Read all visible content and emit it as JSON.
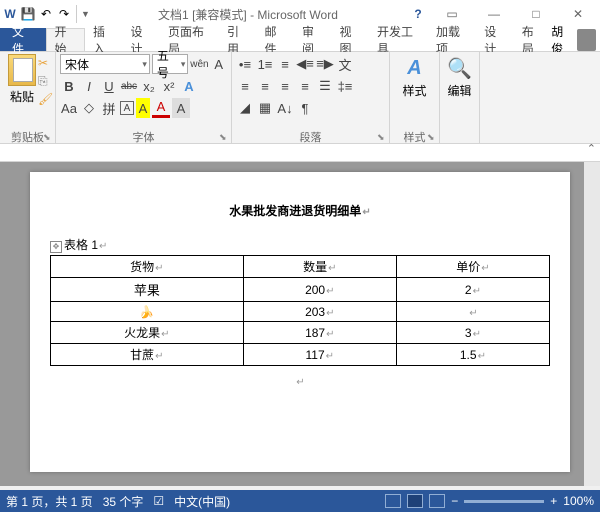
{
  "title": {
    "doc": "文档1",
    "mode": "[兼容模式]",
    "app": "Microsoft Word"
  },
  "qat": {
    "save": "💾",
    "undo": "↶",
    "redo": "↷"
  },
  "menu": {
    "file": "文件",
    "home": "开始",
    "insert": "插入",
    "design": "设计",
    "layout": "页面布局",
    "refs": "引用",
    "mail": "邮件",
    "review": "审阅",
    "view": "视图",
    "dev": "开发工具",
    "addin": "加载项",
    "design2": "设计",
    "layout2": "布局",
    "user": "胡俊"
  },
  "ribbon": {
    "clipboard": {
      "paste": "粘贴",
      "label": "剪贴板"
    },
    "font": {
      "name": "宋体",
      "size": "五号",
      "grow": "wên",
      "shrink": "A",
      "clear": "Aa",
      "label": "字体",
      "bold": "B",
      "italic": "I",
      "underline": "U",
      "strike": "abc",
      "sub": "x₂",
      "sup": "x²",
      "effects": "A",
      "highlight": "A",
      "color": "A"
    },
    "para": {
      "label": "段落"
    },
    "styles": {
      "label": "样式",
      "btn": "样式"
    },
    "edit": {
      "label": "编辑",
      "btn": "编辑",
      "find": "🔍"
    }
  },
  "document": {
    "title": "水果批发商进退货明细单",
    "table_label": "表格 1",
    "headers": [
      "货物",
      "数量",
      "单价"
    ],
    "rows": [
      [
        "苹果",
        "200",
        "2"
      ],
      [
        "🍌",
        "203",
        ""
      ],
      [
        "火龙果",
        "187",
        "3"
      ],
      [
        "甘蔗",
        "117",
        "1.5"
      ]
    ]
  },
  "status": {
    "page": "第 1 页，共 1 页",
    "words": "35 个字",
    "lang": "中文(中国)",
    "zoom": "100%",
    "minus": "−",
    "plus": "+"
  }
}
